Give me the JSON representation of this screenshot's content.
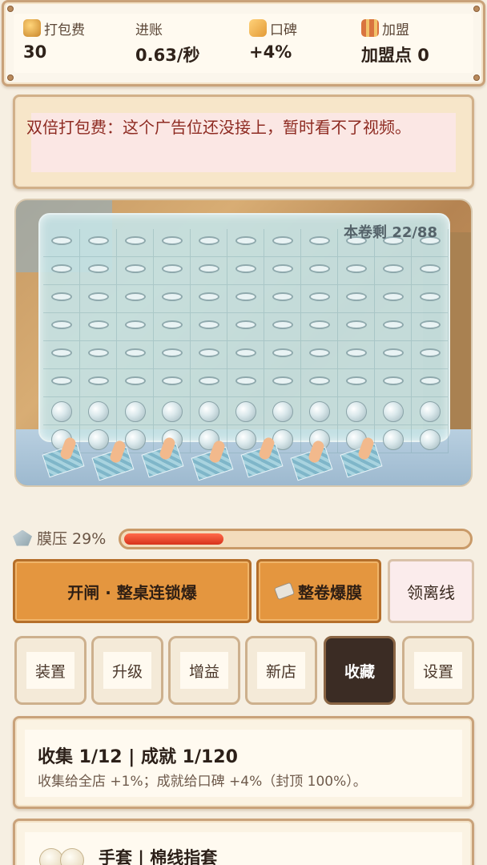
{
  "stats": [
    {
      "label": "打包费",
      "value": "30",
      "icon": "coin-stack-icon",
      "color": "#d99a3b"
    },
    {
      "label": "进账",
      "value": "0.63/秒",
      "icon": "",
      "color": ""
    },
    {
      "label": "口碑",
      "value": "+4%",
      "icon": "thumbs-up-icon",
      "color": "#e7a540"
    },
    {
      "label": "加盟",
      "value": "加盟点 0",
      "icon": "gift-box-icon",
      "color": "#c8643a"
    }
  ],
  "notice": {
    "text": "双倍打包费：这个广告位还没接上，暂时看不了视频。"
  },
  "board": {
    "remaining_label": "本卷剩 22/88",
    "remaining": 22,
    "total": 88,
    "columns": 11,
    "rows": 8,
    "popped_rows": 6
  },
  "pressure": {
    "label": "膜压 29%",
    "percent": 29,
    "icon": "diamond-icon"
  },
  "actions": {
    "chain_label": "开闸 · 整桌连锁爆",
    "roll_label": "整卷爆膜",
    "roll_icon": "tape-roll-icon",
    "leave_label": "领离线"
  },
  "tabs": [
    {
      "label": "装置",
      "active": false
    },
    {
      "label": "升级",
      "active": false
    },
    {
      "label": "增益",
      "active": false
    },
    {
      "label": "新店",
      "active": false
    },
    {
      "label": "收藏",
      "active": true
    },
    {
      "label": "设置",
      "active": false
    }
  ],
  "summary": {
    "title": "收集 1/12 | 成就 1/120",
    "desc": "收集给全店 +1%；成就给口碑 +4%（封顶 100%）。"
  },
  "item": {
    "title": "手套 | 棉线指套",
    "icon": "glove-icon"
  }
}
